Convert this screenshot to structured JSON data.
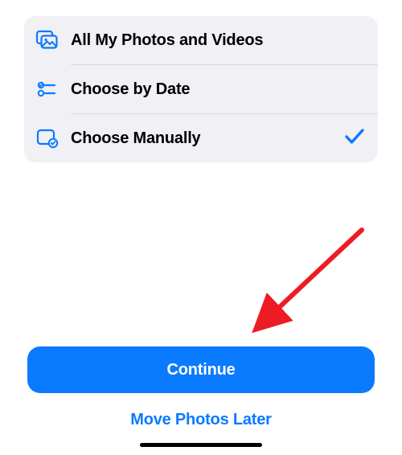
{
  "options": [
    {
      "icon": "photos-icon",
      "label": "All My Photos and Videos",
      "selected": false
    },
    {
      "icon": "date-sliders-icon",
      "label": "Choose by Date",
      "selected": false
    },
    {
      "icon": "manual-select-icon",
      "label": "Choose Manually",
      "selected": true
    }
  ],
  "buttons": {
    "continue": "Continue",
    "later": "Move Photos Later"
  },
  "colors": {
    "accent": "#0a7aff",
    "panel": "#f1f0f5"
  }
}
